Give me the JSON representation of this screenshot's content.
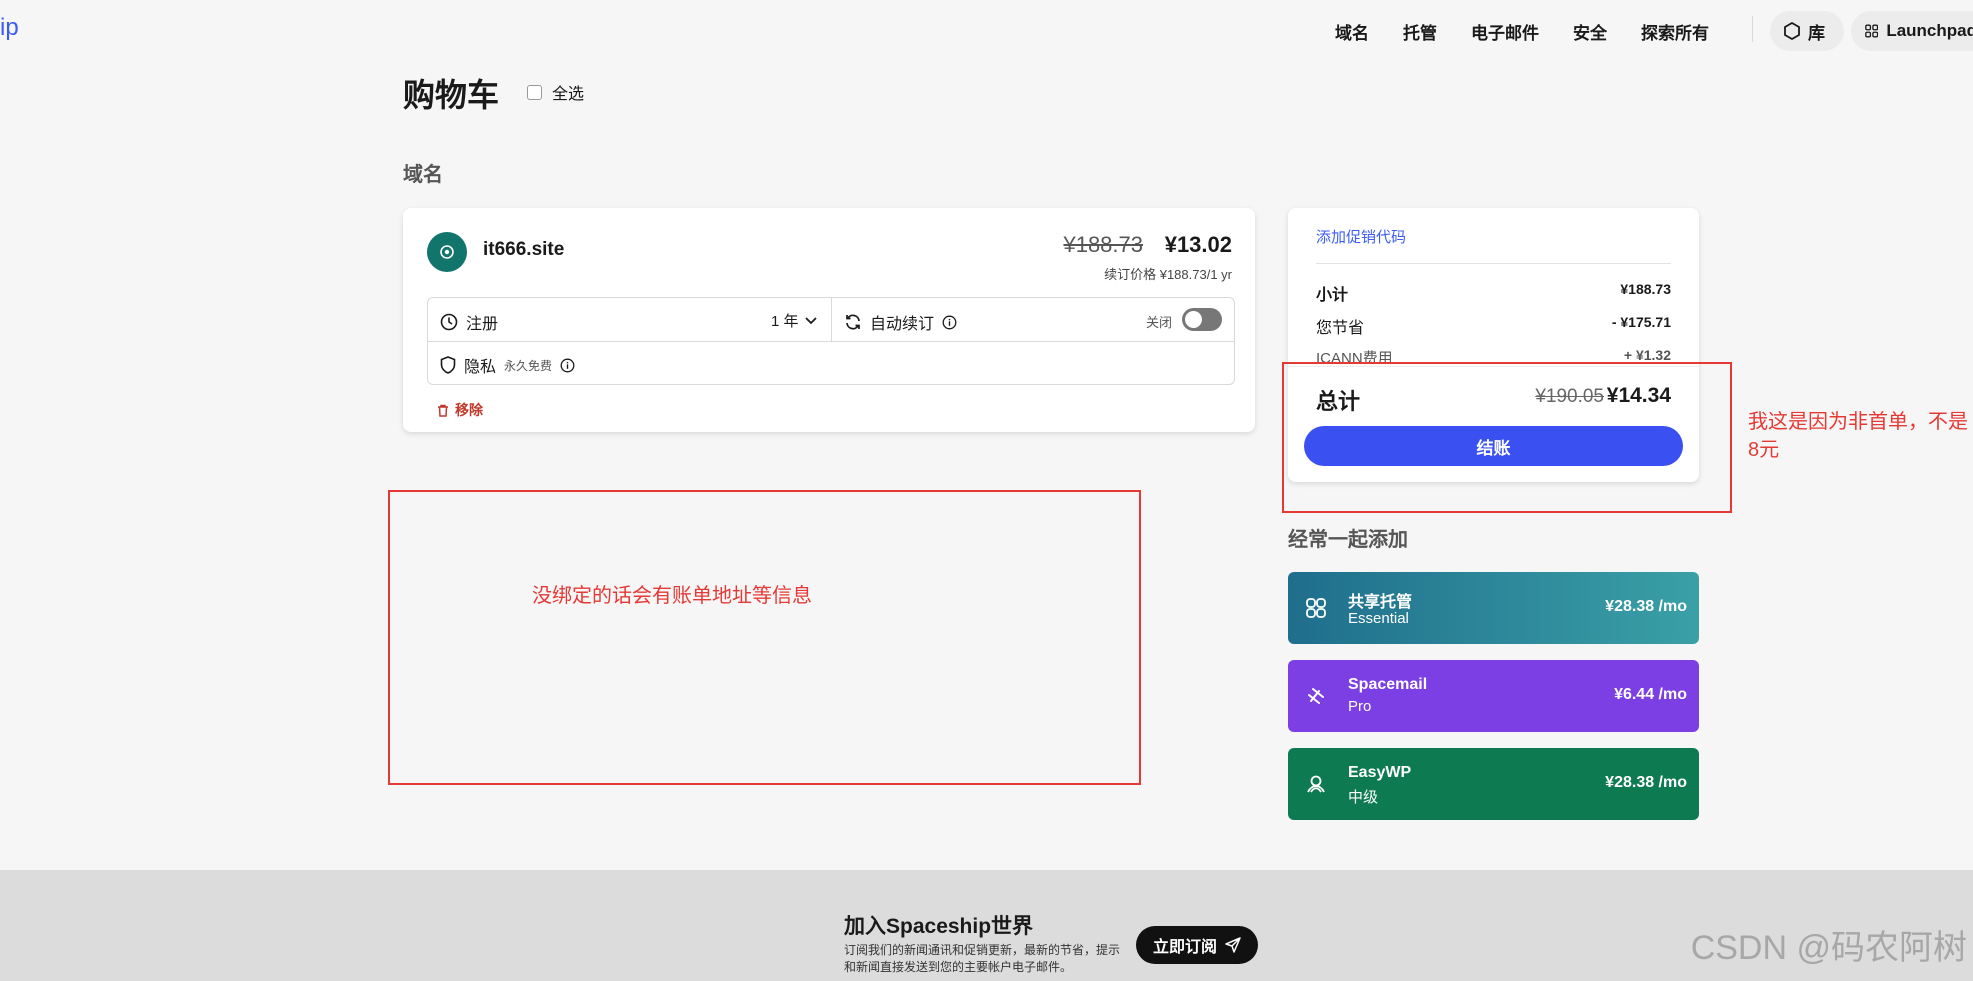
{
  "nav": {
    "brand": "ip",
    "links": [
      "域名",
      "托管",
      "电子邮件",
      "安全",
      "探索所有"
    ],
    "library": "库",
    "launchpad": "Launchpad"
  },
  "page": {
    "title": "购物车",
    "select_all": "全选",
    "section_domains": "域名"
  },
  "domain_item": {
    "name": "it666.site",
    "price_old": "¥188.73",
    "price_new": "¥13.02",
    "renewal": "续订价格 ¥188.73/1 yr",
    "register_label": "注册",
    "years": "1 年",
    "auto_renew_label": "自动续订",
    "toggle_state": "关闭",
    "privacy_label": "隐私",
    "privacy_note": "永久免费",
    "remove_label": "移除"
  },
  "summary": {
    "promo_link": "添加促销代码",
    "subtotal_label": "小计",
    "subtotal_value": "¥188.73",
    "savings_label": "您节省",
    "savings_value": "- ¥175.71",
    "icann_label": "ICANN费用",
    "icann_value": "+ ¥1.32",
    "total_label": "总计",
    "total_old": "¥190.05",
    "total_new": "¥14.34",
    "checkout_label": "结账"
  },
  "annotations": {
    "left_note": "没绑定的话会有账单地址等信息",
    "right_note": "我这是因为非首单，不是8元"
  },
  "addons": {
    "title": "经常一起添加",
    "items": [
      {
        "name": "共享托管",
        "sub": "Essential",
        "price": "¥28.38 /mo",
        "icon": "hosting-icon"
      },
      {
        "name": "Spacemail",
        "sub": "Pro",
        "price": "¥6.44 /mo",
        "icon": "spacemail-icon"
      },
      {
        "name": "EasyWP",
        "sub": "中级",
        "price": "¥28.38 /mo",
        "icon": "easywp-icon"
      }
    ]
  },
  "footer": {
    "title": "加入Spaceship世界",
    "text": "订阅我们的新闻通讯和促销更新，最新的节省，提示和新闻直接发送到您的主要帐户电子邮件。",
    "subscribe_label": "立即订阅",
    "watermark": "CSDN @码农阿树"
  },
  "colors": {
    "accent": "#3b50f0",
    "annotation": "#e53935",
    "remove": "#c0392b"
  }
}
